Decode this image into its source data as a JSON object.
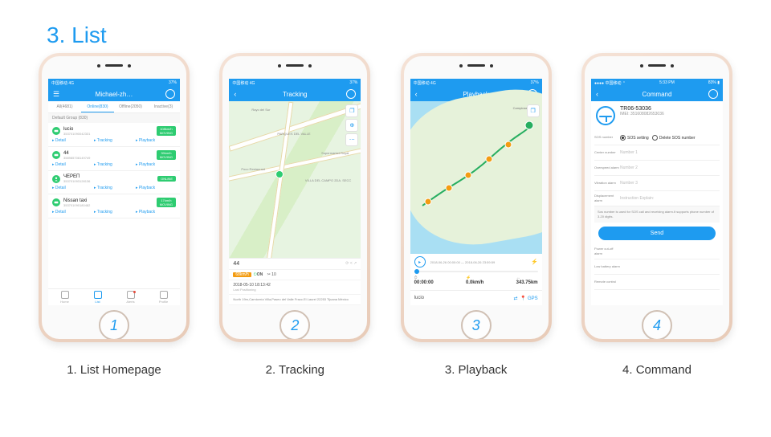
{
  "pageTitle": "3. List",
  "captions": [
    "1. List Homepage",
    "2. Tracking",
    "3. Playback",
    "4. Command"
  ],
  "status": {
    "left": "中国移动  4G",
    "time": "5:33 PM",
    "right": "37%"
  },
  "s1": {
    "header": "Michael-zh…",
    "tabs": [
      "All(4681)",
      "Online(830)",
      "Offline(2050)",
      "Inactive(3)"
    ],
    "group": "Default Group  (830)",
    "devices": [
      {
        "name": "lucio",
        "imei": "353701090042331",
        "badge": "108km/h",
        "badge2": "MOVING",
        "type": "car"
      },
      {
        "name": "44",
        "imei": "358985708149749",
        "badge": "39km/h",
        "badge2": "MOVING",
        "type": "car"
      },
      {
        "name": "ЧЕРЕП",
        "imei": "353701093128136",
        "badge": "ONLINE",
        "badge2": "",
        "type": "person"
      },
      {
        "name": "Nissan taxi",
        "imei": "353701090180482",
        "badge": "17km/h",
        "badge2": "MOVING",
        "type": "car"
      }
    ],
    "actions": [
      "Detail",
      "Tracking",
      "Playback"
    ],
    "tabbar": [
      "Home",
      "List",
      "Alerts",
      "Profile"
    ]
  },
  "s2": {
    "header": "Tracking",
    "labels": [
      "Rayo del Sur",
      "PARQUES DEL VALLE",
      "Poco Restaurant",
      "Supermarket Royal",
      "VILLA DEL CAMPO 2DA. SECC"
    ],
    "name": "44",
    "tag": "68km/h",
    "status": "ON",
    "date": "2018-05-10  18:13:42",
    "addr": "North 19m,Carnicería Villa,Paseo del Valle Fracc.El Laurel 22253 Tijuana México"
  },
  "s3": {
    "header": "Playback",
    "city": "Campinas",
    "start": "2018-06-26 00:00:00",
    "end": "2018-06-26 23:59:59",
    "stats": [
      {
        "v": "00:00:00",
        "l": ""
      },
      {
        "v": "0.0km/h",
        "l": ""
      },
      {
        "v": "343.75km",
        "l": ""
      }
    ],
    "dev": "lucio",
    "mode": "GPS"
  },
  "s4": {
    "header": "Command",
    "devName": "TR06-53036",
    "imei": "IMEI:  351608082653036",
    "rows": [
      {
        "l": "SOS number",
        "v": "",
        "type": "radio",
        "opts": [
          "SOS setting",
          "Delete SOS number"
        ]
      },
      {
        "l": "Center number",
        "v": "Number 1"
      },
      {
        "l": "Overspeed alarm",
        "v": "Number 2"
      },
      {
        "l": "Vibration alarm",
        "v": "Number 3"
      },
      {
        "l": "Displacement alarm",
        "v": "Instruction Explain:"
      },
      {
        "l": "Power cut-off alarm",
        "v": ""
      },
      {
        "l": "Low battery alarm",
        "v": ""
      },
      {
        "l": "Remote control",
        "v": ""
      }
    ],
    "help": "Sos number is used for SOS call and receiving alarm.It supports phone number of 3-20 digits.",
    "send": "Send"
  }
}
